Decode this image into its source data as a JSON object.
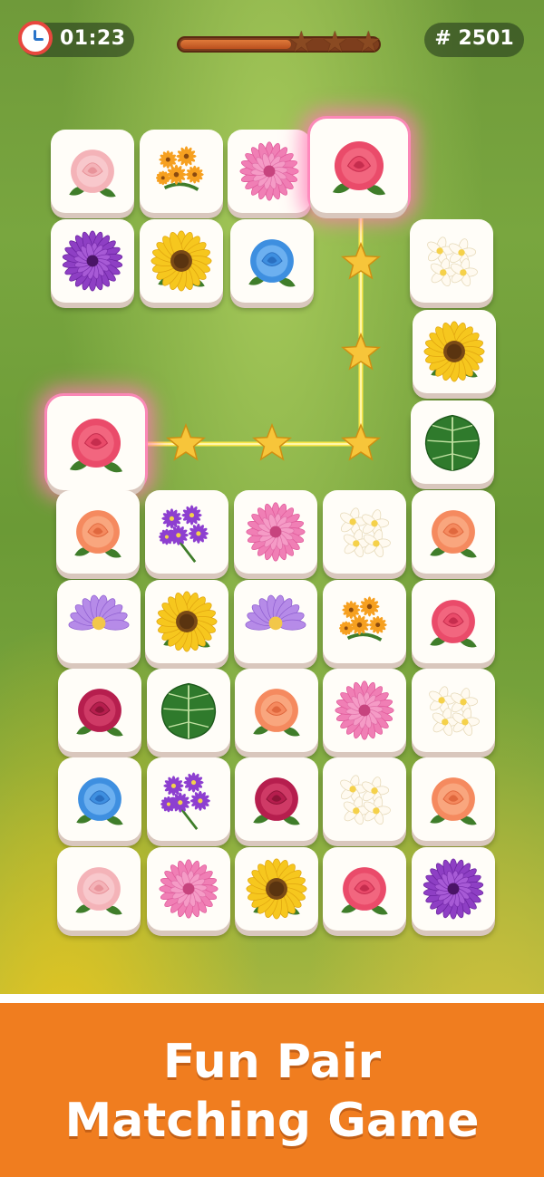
{
  "hud": {
    "timer": "01:23",
    "level": "# 2501",
    "progress": 0.55,
    "stars": 3
  },
  "banner": {
    "line1": "Fun Pair",
    "line2": "Matching Game"
  },
  "colors": {
    "banner": "#f07d1f",
    "path": "#ffe94a",
    "highlight": "#ff78b4"
  },
  "tiles": [
    {
      "id": "t-r0c0",
      "flower": "pink-rose",
      "selected": false
    },
    {
      "id": "t-r0c1",
      "flower": "orange-daisy-bouquet",
      "selected": false
    },
    {
      "id": "t-r0c2",
      "flower": "pink-gerbera",
      "selected": false
    },
    {
      "id": "t-r0c3",
      "flower": "red-rose",
      "selected": true
    },
    {
      "id": "t-r1c0",
      "flower": "purple-gerbera",
      "selected": false
    },
    {
      "id": "t-r1c1",
      "flower": "sunflower",
      "selected": false
    },
    {
      "id": "t-r1c2",
      "flower": "blue-rose",
      "selected": false
    },
    {
      "id": "t-r1c4",
      "flower": "white-plumeria",
      "selected": false
    },
    {
      "id": "t-r2c4",
      "flower": "sunflower",
      "selected": false
    },
    {
      "id": "t-r3c0",
      "flower": "red-rose",
      "selected": true
    },
    {
      "id": "t-r3c4",
      "flower": "monstera-leaf",
      "selected": false
    },
    {
      "id": "t-r4c0",
      "flower": "orange-rose",
      "selected": false
    },
    {
      "id": "t-r4c1",
      "flower": "purple-daisy-bouquet",
      "selected": false
    },
    {
      "id": "t-r4c2",
      "flower": "pink-gerbera",
      "selected": false
    },
    {
      "id": "t-r4c3",
      "flower": "white-plumeria",
      "selected": false
    },
    {
      "id": "t-r4c4",
      "flower": "orange-rose",
      "selected": false
    },
    {
      "id": "t-r5c0",
      "flower": "purple-lotus",
      "selected": false
    },
    {
      "id": "t-r5c1",
      "flower": "sunflower",
      "selected": false
    },
    {
      "id": "t-r5c2",
      "flower": "purple-lotus",
      "selected": false
    },
    {
      "id": "t-r5c3",
      "flower": "orange-daisy-bouquet",
      "selected": false
    },
    {
      "id": "t-r5c4",
      "flower": "red-rose",
      "selected": false
    },
    {
      "id": "t-r6c0",
      "flower": "crimson-rose",
      "selected": false
    },
    {
      "id": "t-r6c1",
      "flower": "monstera-leaf",
      "selected": false
    },
    {
      "id": "t-r6c2",
      "flower": "orange-rose",
      "selected": false
    },
    {
      "id": "t-r6c3",
      "flower": "pink-gerbera",
      "selected": false
    },
    {
      "id": "t-r6c4",
      "flower": "white-plumeria",
      "selected": false
    },
    {
      "id": "t-r7c0",
      "flower": "blue-rose",
      "selected": false
    },
    {
      "id": "t-r7c1",
      "flower": "purple-daisy-bouquet",
      "selected": false
    },
    {
      "id": "t-r7c2",
      "flower": "crimson-rose",
      "selected": false
    },
    {
      "id": "t-r7c3",
      "flower": "white-plumeria",
      "selected": false
    },
    {
      "id": "t-r7c4",
      "flower": "orange-rose",
      "selected": false
    },
    {
      "id": "t-r8c0",
      "flower": "pink-rose",
      "selected": false
    },
    {
      "id": "t-r8c1",
      "flower": "pink-gerbera",
      "selected": false
    },
    {
      "id": "t-r8c2",
      "flower": "sunflower",
      "selected": false
    },
    {
      "id": "t-r8c3",
      "flower": "red-rose",
      "selected": false
    },
    {
      "id": "t-r8c4",
      "flower": "purple-gerbera",
      "selected": false
    }
  ]
}
